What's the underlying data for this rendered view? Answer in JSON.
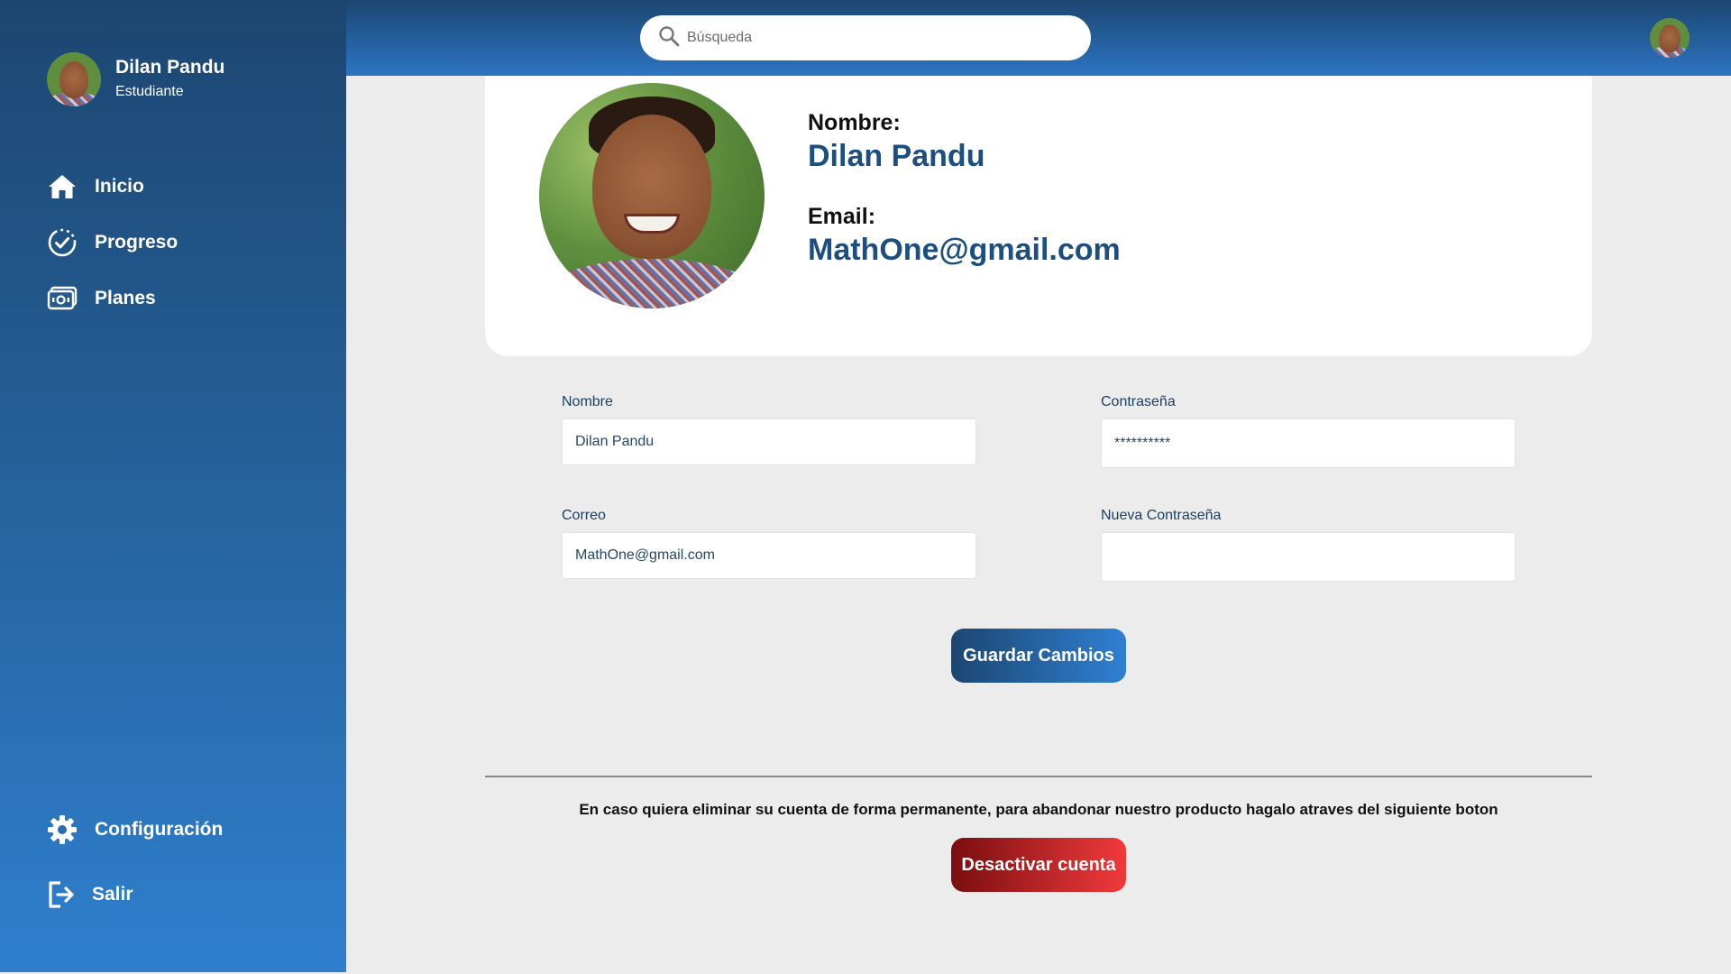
{
  "sidebar": {
    "user": {
      "name": "Dilan Pandu",
      "role": "Estudiante"
    },
    "items": [
      {
        "label": "Inicio",
        "icon": "home-icon"
      },
      {
        "label": "Progreso",
        "icon": "progress-check-icon"
      },
      {
        "label": "Planes",
        "icon": "money-bill-icon"
      }
    ],
    "bottom_items": [
      {
        "label": "Configuración",
        "icon": "gear-icon"
      },
      {
        "label": "Salir",
        "icon": "logout-icon"
      }
    ]
  },
  "topbar": {
    "search_placeholder": "Búsqueda"
  },
  "profile_card": {
    "name_label": "Nombre:",
    "name_value": "Dilan Pandu",
    "email_label": "Email:",
    "email_value": "MathOne@gmail.com"
  },
  "form": {
    "nombre_label": "Nombre",
    "nombre_value": "Dilan Pandu",
    "contrasena_label": "Contraseña",
    "contrasena_value": "**********",
    "correo_label": "Correo",
    "correo_value": "MathOne@gmail.com",
    "nueva_contrasena_label": "Nueva Contraseña",
    "nueva_contrasena_value": "",
    "save_label": "Guardar Cambios"
  },
  "danger_zone": {
    "warning_text": "En caso quiera eliminar su cuenta de forma permanente, para abandonar nuestro producto hagalo atraves del siguiente boton",
    "delete_label": "Desactivar cuenta"
  },
  "colors": {
    "sidebar_top": "#1c4671",
    "sidebar_bottom": "#2f7fce",
    "accent_text": "#1c4f80",
    "danger": "#e02a2c"
  }
}
